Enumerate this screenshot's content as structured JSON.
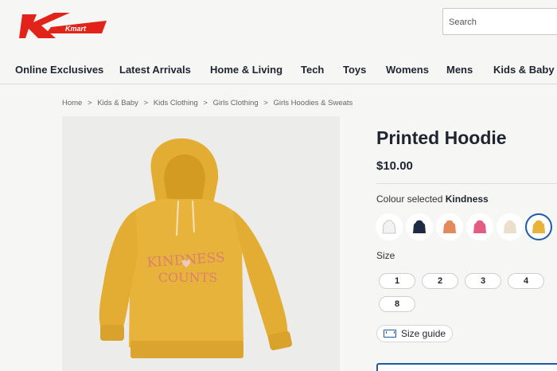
{
  "header": {
    "logo_text": "Kmart",
    "search": {
      "placeholder": "Search"
    }
  },
  "nav": {
    "items": [
      "Online Exclusives",
      "Latest Arrivals",
      "Home & Living",
      "Tech",
      "Toys",
      "Womens",
      "Mens",
      "Kids & Baby"
    ]
  },
  "breadcrumb": [
    "Home",
    ">",
    "Kids & Baby",
    ">",
    "Kids Clothing",
    ">",
    "Girls Clothing",
    ">",
    "Girls Hoodies & Sweats"
  ],
  "product": {
    "title": "Printed Hoodie",
    "price": "$10.00",
    "image_print_line1": "KINDNESS",
    "image_print_line2": "COUNTS",
    "colour_prefix": "Colour selected ",
    "colour_selected": "Kindness",
    "swatches": [
      {
        "color": "#f2f2f2",
        "icon": "white-hoodie-icon"
      },
      {
        "color": "#1f2a44",
        "icon": "navy-hoodie-icon"
      },
      {
        "color": "#e38a5c",
        "icon": "orange-hoodie-icon"
      },
      {
        "color": "#e45c82",
        "icon": "pink-hoodie-icon"
      },
      {
        "color": "#eadfca",
        "icon": "cream-hoodie-icon"
      },
      {
        "color": "#e8b33a",
        "icon": "mustard-hoodie-icon",
        "selected": true
      }
    ],
    "size_label": "Size",
    "sizes": [
      "1",
      "2",
      "3",
      "4",
      "8"
    ],
    "size_guide": "Size guide"
  },
  "colors": {
    "brand_red": "#e2231a",
    "accent_blue": "#1c5ba8",
    "hoodie": "#e8b33a"
  }
}
